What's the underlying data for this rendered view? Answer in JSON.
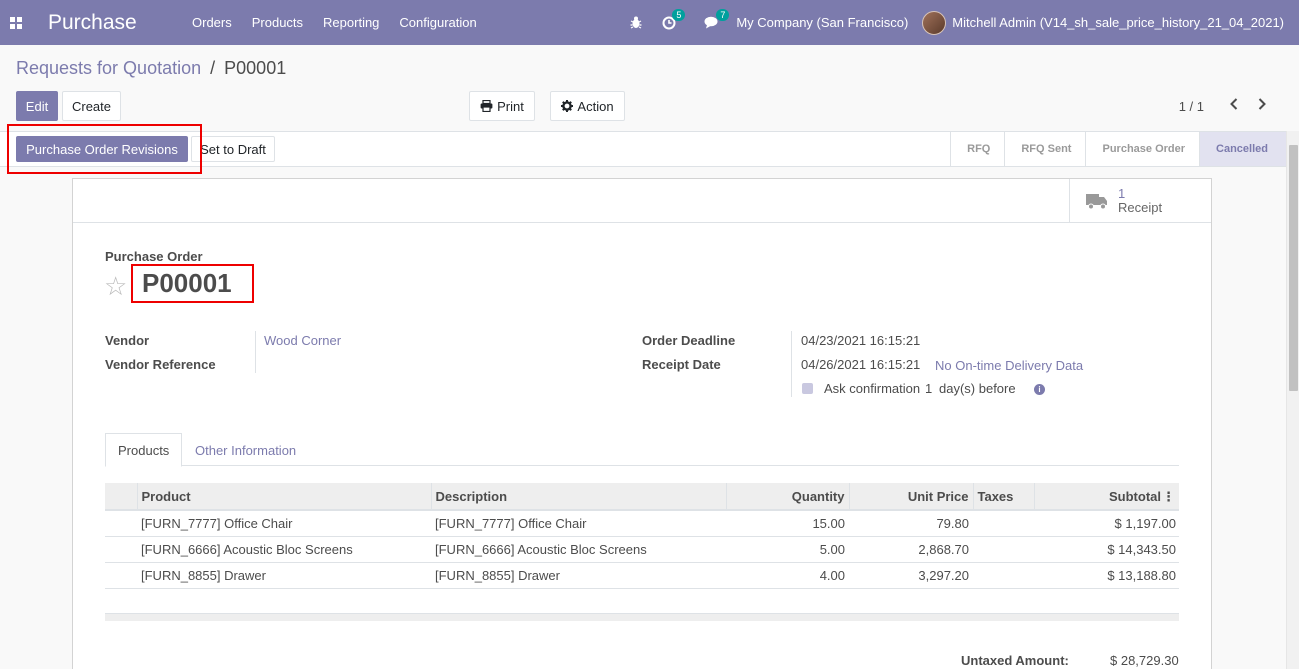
{
  "navbar": {
    "app_name": "Purchase",
    "menu": [
      "Orders",
      "Products",
      "Reporting",
      "Configuration"
    ],
    "activity_count": "5",
    "messages_count": "7",
    "company": "My Company (San Francisco)",
    "user": "Mitchell Admin (V14_sh_sale_price_history_21_04_2021)"
  },
  "breadcrumb": {
    "parent": "Requests for Quotation",
    "separator": "/",
    "current": "P00001"
  },
  "buttons": {
    "edit": "Edit",
    "create": "Create",
    "print": "Print",
    "action": "Action"
  },
  "pager": {
    "value": "1 / 1"
  },
  "header_buttons": {
    "revisions": "Purchase Order Revisions",
    "set_to_draft": "Set to Draft"
  },
  "stages": [
    "RFQ",
    "RFQ Sent",
    "Purchase Order",
    "Cancelled"
  ],
  "current_stage": "Cancelled",
  "smart_button": {
    "count": "1",
    "label": "Receipt"
  },
  "form": {
    "title_label": "Purchase Order",
    "name": "P00001",
    "vendor_label": "Vendor",
    "vendor": "Wood Corner",
    "vendor_ref_label": "Vendor Reference",
    "deadline_label": "Order Deadline",
    "deadline": "04/23/2021 16:15:21",
    "receipt_label": "Receipt Date",
    "receipt_date": "04/26/2021 16:15:21",
    "ontime": "No On-time Delivery Data",
    "confirm_text": "Ask confirmation",
    "confirm_days": "1",
    "confirm_suffix": "day(s) before"
  },
  "tabs": [
    "Products",
    "Other Information"
  ],
  "table": {
    "columns": [
      "Product",
      "Description",
      "Quantity",
      "Unit Price",
      "Taxes",
      "Subtotal"
    ],
    "rows": [
      [
        "[FURN_7777] Office Chair",
        "[FURN_7777] Office Chair",
        "15.00",
        "79.80",
        "",
        "$ 1,197.00"
      ],
      [
        "[FURN_6666] Acoustic Bloc Screens",
        "[FURN_6666] Acoustic Bloc Screens",
        "5.00",
        "2,868.70",
        "",
        "$ 14,343.50"
      ],
      [
        "[FURN_8855] Drawer",
        "[FURN_8855] Drawer",
        "4.00",
        "3,297.20",
        "",
        "$ 13,188.80"
      ]
    ]
  },
  "totals": {
    "untaxed_label": "Untaxed Amount:",
    "untaxed": "$ 28,729.30"
  }
}
